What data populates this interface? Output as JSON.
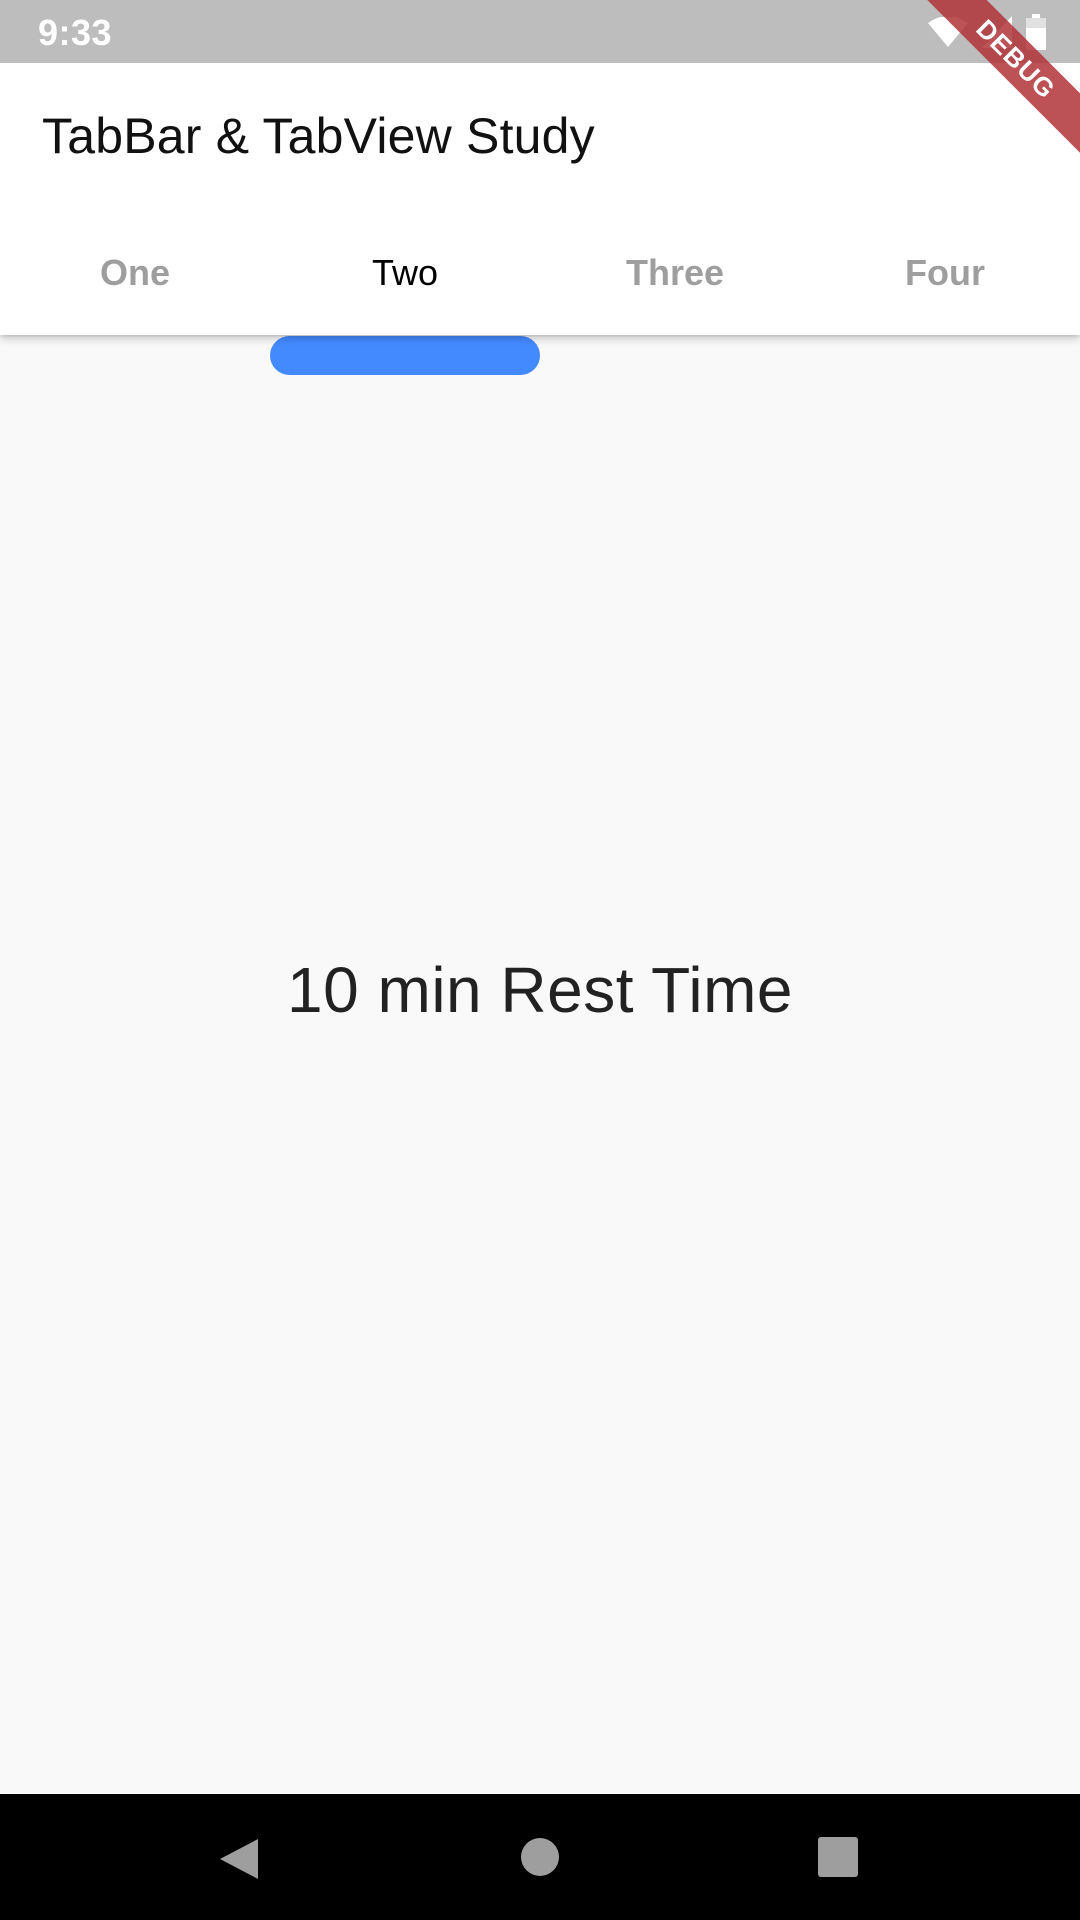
{
  "status_bar": {
    "time": "9:33",
    "icons": [
      "wifi-icon",
      "signal-icon",
      "battery-icon"
    ],
    "background": "#bdbdbd"
  },
  "debug_banner": {
    "label": "DEBUG",
    "color": "#b03238"
  },
  "app_bar": {
    "title": "TabBar & TabView Study",
    "tabs": [
      {
        "label": "One",
        "active": false
      },
      {
        "label": "Two",
        "active": true
      },
      {
        "label": "Three",
        "active": false
      },
      {
        "label": "Four",
        "active": false
      }
    ],
    "indicator_color": "#448aff",
    "active_tab_color": "#000000",
    "inactive_tab_color": "#9e9e9e"
  },
  "body": {
    "text": "10 min Rest Time",
    "background": "#f9f9f9"
  },
  "nav_bar": {
    "buttons": [
      "back-icon",
      "home-icon",
      "recents-icon"
    ]
  }
}
